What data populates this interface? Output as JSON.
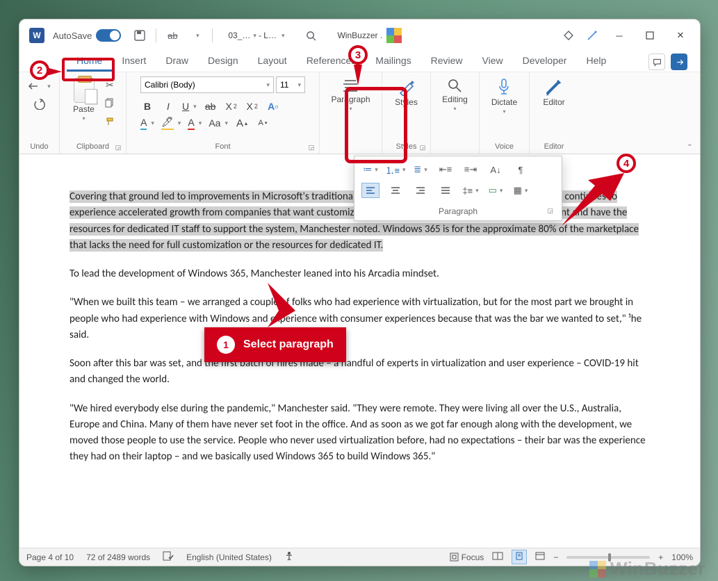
{
  "titlebar": {
    "autosave_label": "AutoSave",
    "autosave_on": true,
    "filename_short": "03_…",
    "filename_saved": "- L…",
    "user_area": "WinBuzzer ."
  },
  "tabs": {
    "items": [
      "Home",
      "Insert",
      "Draw",
      "Design",
      "Layout",
      "References",
      "Mailings",
      "Review",
      "View",
      "Developer",
      "Help"
    ],
    "active": "Home"
  },
  "ribbon": {
    "undo_label": "Undo",
    "clipboard": {
      "paste_label": "Paste",
      "group_label": "Clipboard"
    },
    "font": {
      "name": "Calibri (Body)",
      "size": "11",
      "group_label": "Font"
    },
    "paragraph": {
      "btn_label": "Paragraph",
      "popup_label": "Paragraph"
    },
    "styles": {
      "btn_label": "Styles",
      "group_label": "Styles"
    },
    "editing": {
      "btn_label": "Editing"
    },
    "dictate": {
      "btn_label": "Dictate",
      "group_label": "Voice"
    },
    "editor": {
      "btn_label": "Editor",
      "group_label": "Editor"
    }
  },
  "paragraphs": {
    "p1": "Covering that ground led to improvements in Microsoft's traditional VDI offering, Azure Virtual Desktop. This offering continues to experience accelerated growth from companies that want customization and control over their operating environment and have the resources for dedicated IT staff to support the system, Manchester noted. Windows 365 is for the approximate 80% of the marketplace that lacks the need for full customization or the resources for dedicated IT.",
    "p2": "To lead the development of Windows 365, Manchester leaned into his Arcadia mindset.",
    "p3": "\"When we built this team – we arranged a couple of folks who had experience with virtualization, but for the most part we brought in people who had experience with Windows and experience with consumer experiences because that was the bar we wanted to set,\" ¹he said.",
    "p4": "Soon after this bar was set, and the first batch of hires made – a handful of experts in virtualization and user experience – COVID-19 hit and changed the world.",
    "p5": "\"We hired everybody else during the pandemic,\" Manchester said. \"They were remote. They were living all over the U.S., Australia, Europe and China. Many of them have never set foot in the office. And as soon as we got far enough along with the development, we moved those people to use the service. People who never used virtualization before, had no expectations – their bar was the experience they had on their laptop – and we basically used Windows 365 to build Windows 365.\""
  },
  "statusbar": {
    "page": "Page 4 of 10",
    "words": "72 of 2489 words",
    "language": "English (United States)",
    "focus": "Focus",
    "zoom": "100%"
  },
  "anno": {
    "step1": "Select paragraph"
  },
  "watermark": "WinBuzzer"
}
